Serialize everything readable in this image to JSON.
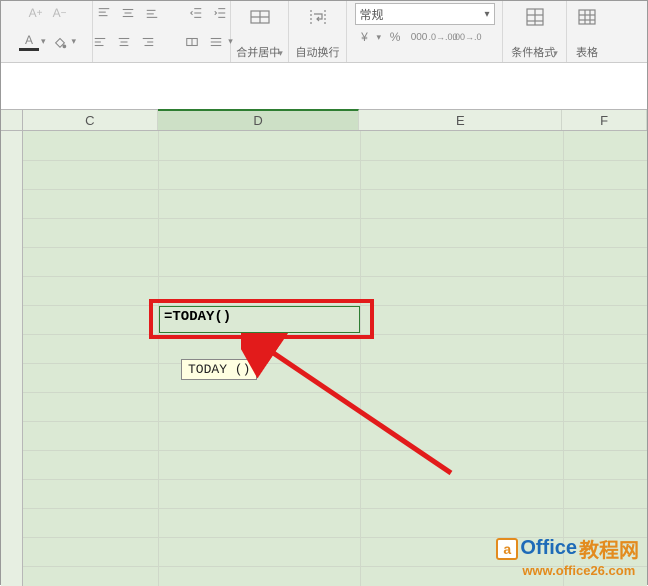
{
  "ribbon": {
    "merge_label": "合并居中",
    "wrap_label": "自动换行",
    "numfmt_selected": "常规",
    "condfmt_label": "条件格式",
    "tablefmt_label": "表格"
  },
  "columns": {
    "c": "C",
    "d": "D",
    "e": "E",
    "f": "F"
  },
  "cell": {
    "formula": "=TODAY()",
    "tooltip": "TODAY ()"
  },
  "watermark": {
    "brand_prefix": "Office",
    "brand_suffix": "教程网",
    "url": "www.office26.com",
    "logo_letter": "a"
  }
}
